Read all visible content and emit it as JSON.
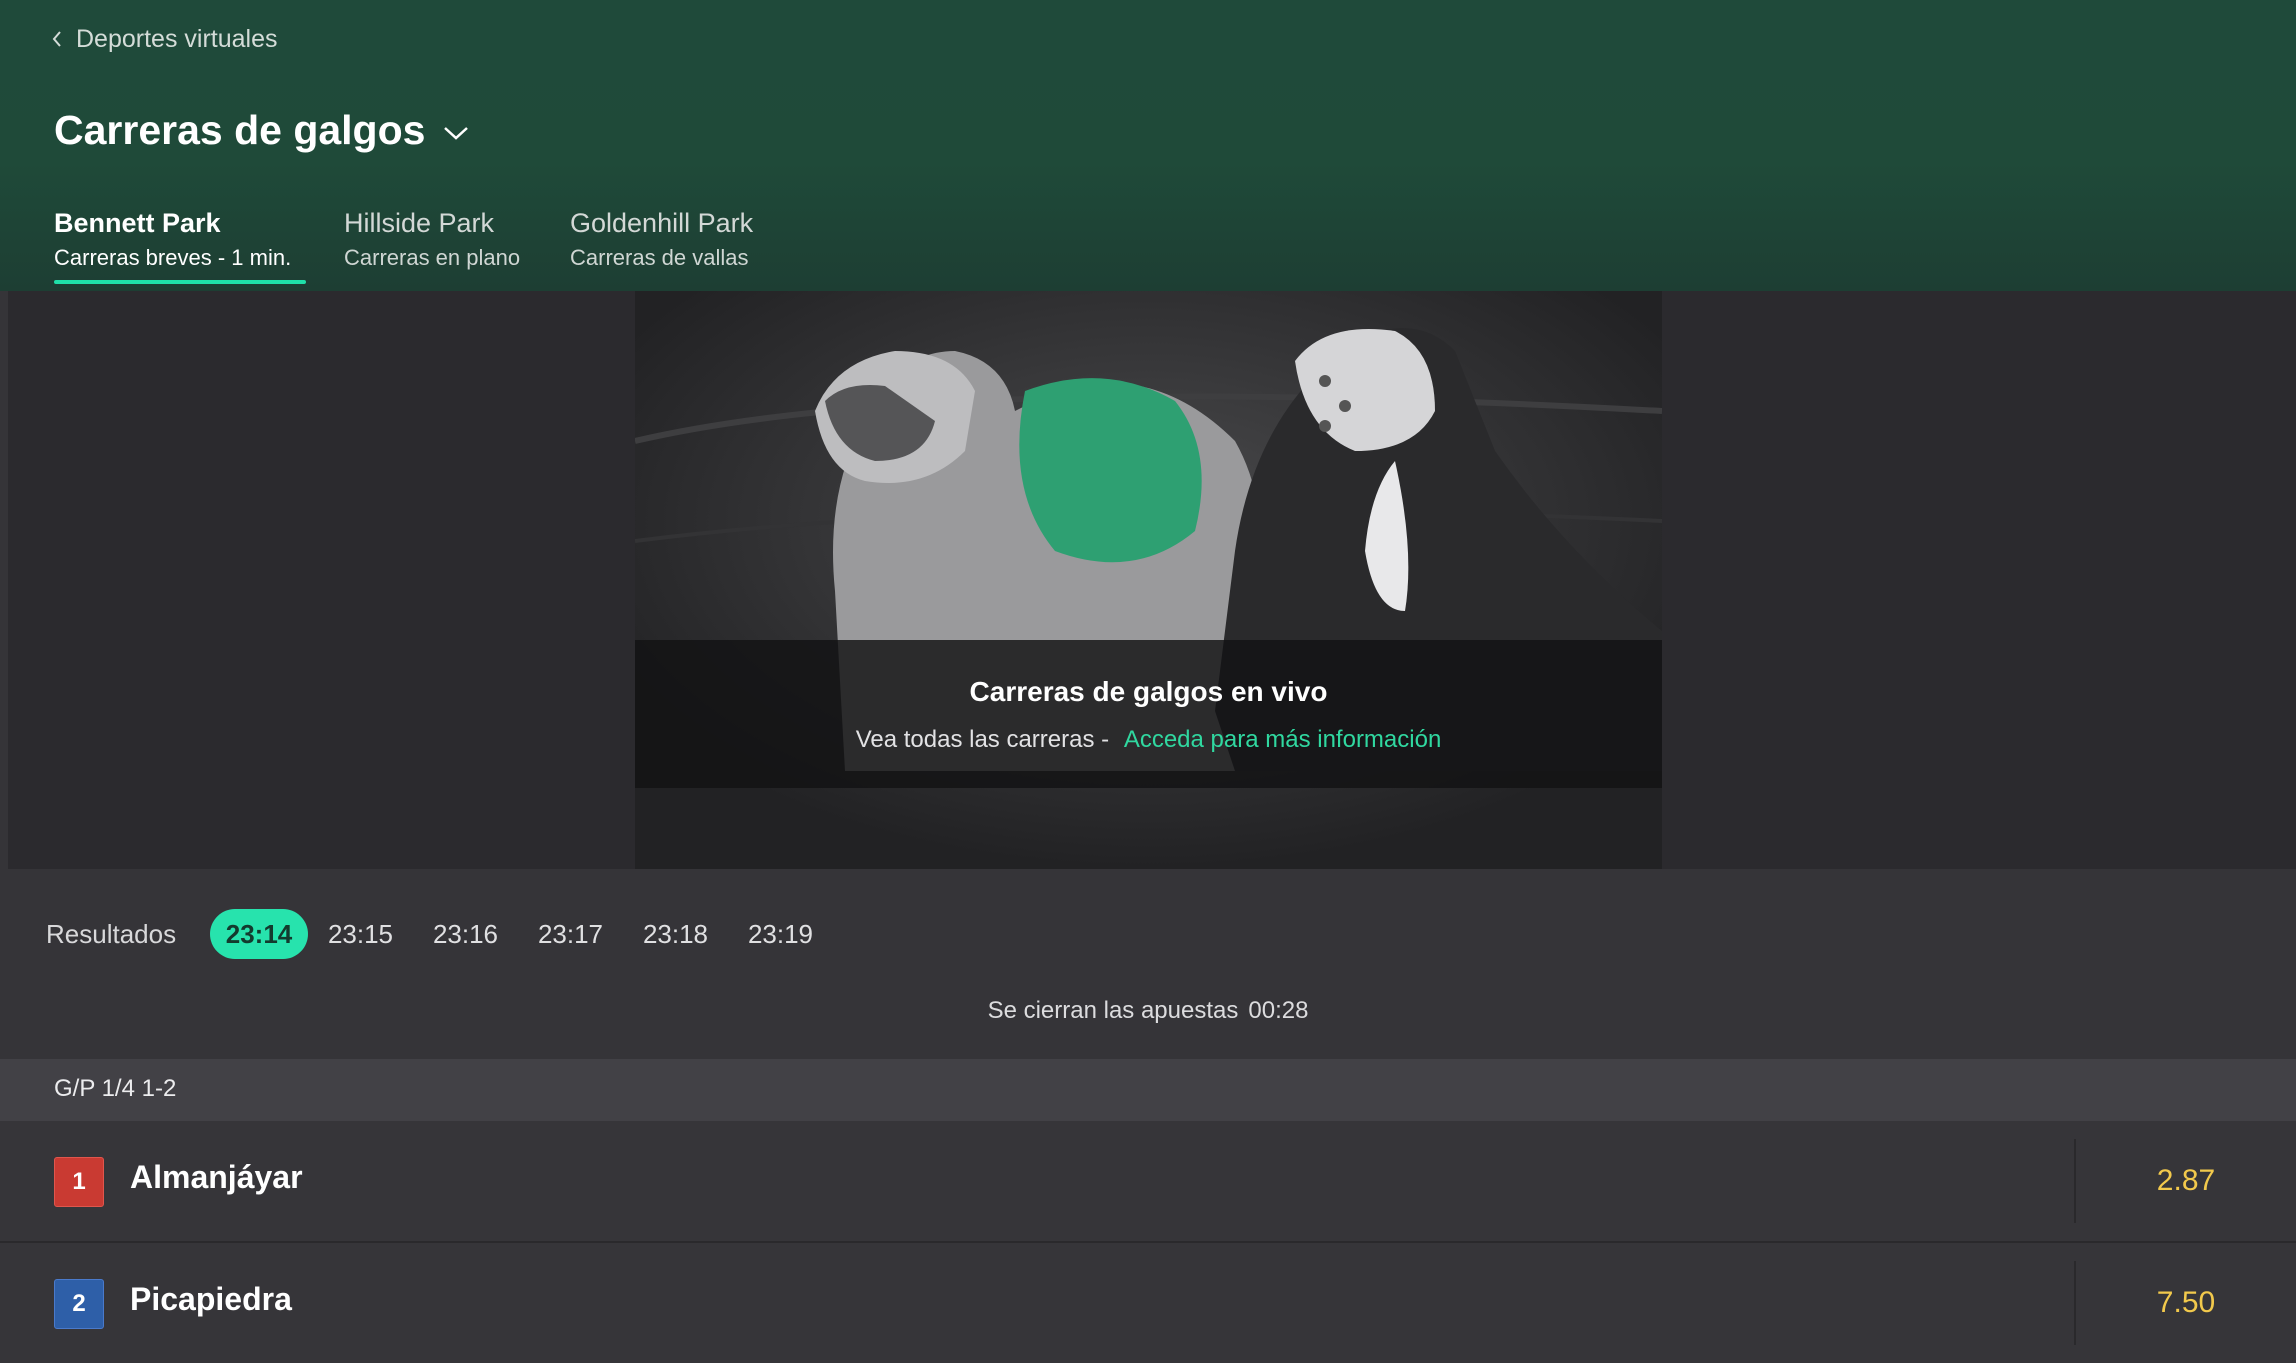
{
  "nav": {
    "back_label": "Deportes virtuales"
  },
  "page": {
    "title": "Carreras de galgos"
  },
  "tabs": [
    {
      "name": "Bennett Park",
      "sub": "Carreras breves - 1 min.",
      "active": true
    },
    {
      "name": "Hillside Park",
      "sub": "Carreras en plano",
      "active": false
    },
    {
      "name": "Goldenhill Park",
      "sub": "Carreras de vallas",
      "active": false
    }
  ],
  "live": {
    "heading": "Carreras de galgos en vivo",
    "text": "Vea todas las carreras -",
    "link": "Acceda para más información"
  },
  "races": {
    "results_label": "Resultados",
    "times": [
      "23:14",
      "23:15",
      "23:16",
      "23:17",
      "23:18",
      "23:19"
    ],
    "selected": "23:14",
    "closing_label": "Se cierran las apuestas",
    "countdown": "00:28"
  },
  "market": {
    "title": "G/P 1/4 1-2",
    "runners": [
      {
        "number": "1",
        "name": "Almanjáyar",
        "odds": "2.87",
        "color": "#c93a32"
      },
      {
        "number": "2",
        "name": "Picapiedra",
        "odds": "7.50",
        "color": "#2e5fa8"
      }
    ]
  },
  "colors": {
    "accent": "#27e3ad",
    "odds": "#f2c94c",
    "link": "#30d8a0"
  }
}
